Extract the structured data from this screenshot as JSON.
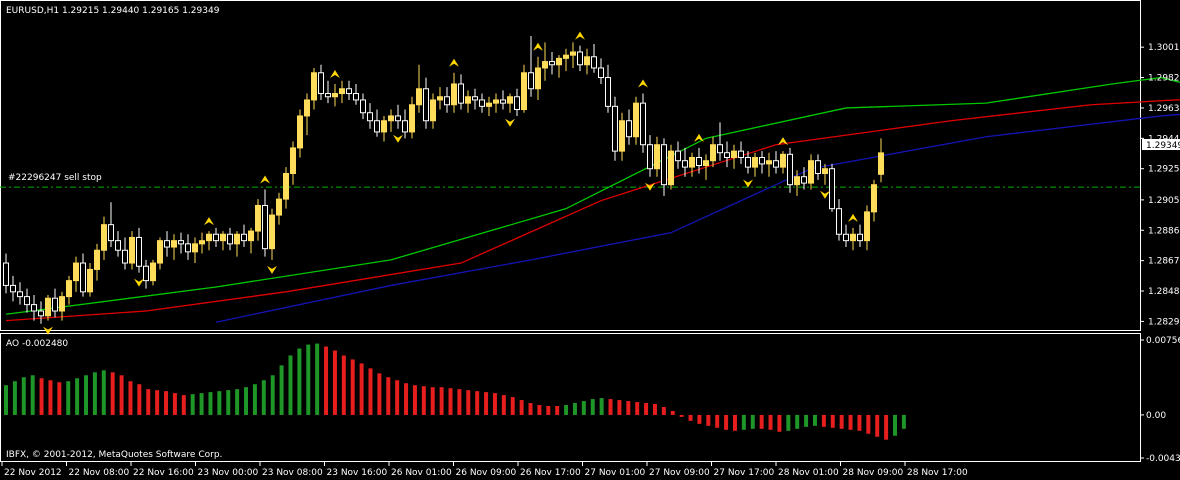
{
  "main_panel": {
    "title": "EURUSD,H1  1.29215 1.29440 1.29165 1.29349",
    "order_label": "#22296247 sell stop",
    "current_price_label": "1.29349"
  },
  "ao_panel": {
    "title": "AO -0.002480"
  },
  "copyright": "IBFX, © 2001-2012, MetaQuotes Software Corp.",
  "colors": {
    "background": "#000000",
    "grid_frame": "#ffffff",
    "bull_candle": "#ffdc5a",
    "bear_candle": "#ffffff",
    "ma_fast": "#00c800",
    "ma_mid": "#e00000",
    "ma_slow": "#1414b4",
    "order_line": "#00b000",
    "fractal": "#ffd700",
    "ao_up": "#1e9628",
    "ao_down": "#e61e1e"
  },
  "chart_data": [
    {
      "type": "candlestick",
      "symbol": "EURUSD",
      "timeframe": "H1",
      "last_bar": {
        "open": 1.29215,
        "high": 1.2944,
        "low": 1.29165,
        "close": 1.29349
      },
      "y_ticks": [
        "1.30010",
        "1.29820",
        "1.29630",
        "1.29440",
        "1.29250",
        "1.29055",
        "1.28865",
        "1.28675",
        "1.28485",
        "1.28295"
      ],
      "ylim": [
        1.2826,
        1.3018
      ],
      "x_ticks": [
        "22 Nov 2012",
        "22 Nov 08:00",
        "22 Nov 16:00",
        "23 Nov 00:00",
        "23 Nov 08:00",
        "23 Nov 16:00",
        "26 Nov 01:00",
        "26 Nov 09:00",
        "26 Nov 17:00",
        "27 Nov 01:00",
        "27 Nov 09:00",
        "27 Nov 17:00",
        "28 Nov 01:00",
        "28 Nov 09:00",
        "28 Nov 17:00"
      ],
      "order_line": {
        "label": "#22296247 sell stop",
        "price": 1.29135
      },
      "candles_ohlc": [
        [
          1.2866,
          1.2872,
          1.2847,
          1.2852
        ],
        [
          1.2852,
          1.2858,
          1.2842,
          1.2848
        ],
        [
          1.2848,
          1.2854,
          1.284,
          1.2845
        ],
        [
          1.2845,
          1.285,
          1.2835,
          1.284
        ],
        [
          1.284,
          1.2846,
          1.283,
          1.2836
        ],
        [
          1.2836,
          1.2842,
          1.2828,
          1.2833
        ],
        [
          1.2833,
          1.2846,
          1.283,
          1.2844
        ],
        [
          1.2844,
          1.285,
          1.2832,
          1.2836
        ],
        [
          1.2836,
          1.2848,
          1.283,
          1.2845
        ],
        [
          1.2845,
          1.2858,
          1.284,
          1.2855
        ],
        [
          1.2855,
          1.287,
          1.2848,
          1.2866
        ],
        [
          1.2866,
          1.2872,
          1.2845,
          1.2848
        ],
        [
          1.2848,
          1.2866,
          1.2845,
          1.2862
        ],
        [
          1.2862,
          1.2878,
          1.2855,
          1.2874
        ],
        [
          1.2874,
          1.2895,
          1.2868,
          1.289
        ],
        [
          1.289,
          1.2904,
          1.2876,
          1.288
        ],
        [
          1.288,
          1.2886,
          1.287,
          1.2874
        ],
        [
          1.2874,
          1.2882,
          1.2862,
          1.2866
        ],
        [
          1.2866,
          1.2886,
          1.2862,
          1.2882
        ],
        [
          1.2882,
          1.2888,
          1.286,
          1.2864
        ],
        [
          1.2864,
          1.2868,
          1.285,
          1.2855
        ],
        [
          1.2855,
          1.2868,
          1.2852,
          1.2866
        ],
        [
          1.2866,
          1.2882,
          1.2862,
          1.288
        ],
        [
          1.288,
          1.2886,
          1.287,
          1.2876
        ],
        [
          1.2876,
          1.2884,
          1.2868,
          1.288
        ],
        [
          1.288,
          1.2885,
          1.2872,
          1.2878
        ],
        [
          1.2878,
          1.2884,
          1.2868,
          1.2873
        ],
        [
          1.2873,
          1.2882,
          1.2866,
          1.2878
        ],
        [
          1.2878,
          1.2885,
          1.2872,
          1.288
        ],
        [
          1.288,
          1.2886,
          1.2874,
          1.2884
        ],
        [
          1.2884,
          1.2888,
          1.2876,
          1.288
        ],
        [
          1.288,
          1.2886,
          1.2874,
          1.2884
        ],
        [
          1.2884,
          1.2888,
          1.2874,
          1.2878
        ],
        [
          1.2878,
          1.2886,
          1.287,
          1.2884
        ],
        [
          1.2884,
          1.289,
          1.2876,
          1.288
        ],
        [
          1.288,
          1.2888,
          1.2872,
          1.2886
        ],
        [
          1.2886,
          1.2906,
          1.288,
          1.2902
        ],
        [
          1.2902,
          1.2912,
          1.287,
          1.2875
        ],
        [
          1.2875,
          1.29,
          1.2868,
          1.2896
        ],
        [
          1.2896,
          1.291,
          1.289,
          1.2906
        ],
        [
          1.2906,
          1.2926,
          1.29,
          1.2922
        ],
        [
          1.2922,
          1.2942,
          1.2915,
          1.2938
        ],
        [
          1.2938,
          1.2962,
          1.2932,
          1.2958
        ],
        [
          1.2958,
          1.2972,
          1.2946,
          1.2968
        ],
        [
          1.2968,
          1.2988,
          1.2962,
          1.2985
        ],
        [
          1.2985,
          1.299,
          1.2968,
          1.2972
        ],
        [
          1.2972,
          1.298,
          1.2966,
          1.297
        ],
        [
          1.297,
          1.2978,
          1.2964,
          1.2972
        ],
        [
          1.2972,
          1.298,
          1.2966,
          1.2975
        ],
        [
          1.2975,
          1.298,
          1.2968,
          1.2972
        ],
        [
          1.2972,
          1.2978,
          1.2965,
          1.2968
        ],
        [
          1.2968,
          1.2972,
          1.2956,
          1.296
        ],
        [
          1.296,
          1.2966,
          1.295,
          1.2955
        ],
        [
          1.2955,
          1.2962,
          1.2945,
          1.2948
        ],
        [
          1.2948,
          1.2958,
          1.2942,
          1.2955
        ],
        [
          1.2955,
          1.2962,
          1.2948,
          1.2958
        ],
        [
          1.2958,
          1.2965,
          1.295,
          1.2955
        ],
        [
          1.2955,
          1.2962,
          1.2944,
          1.2948
        ],
        [
          1.2948,
          1.297,
          1.2944,
          1.2965
        ],
        [
          1.2965,
          1.299,
          1.296,
          1.2975
        ],
        [
          1.2975,
          1.2982,
          1.295,
          1.2955
        ],
        [
          1.2955,
          1.2972,
          1.295,
          1.2968
        ],
        [
          1.2968,
          1.2976,
          1.2962,
          1.297
        ],
        [
          1.297,
          1.2976,
          1.296,
          1.2965
        ],
        [
          1.2965,
          1.2985,
          1.296,
          1.2978
        ],
        [
          1.2978,
          1.2984,
          1.2962,
          1.2966
        ],
        [
          1.2966,
          1.2974,
          1.296,
          1.297
        ],
        [
          1.297,
          1.2975,
          1.2962,
          1.2968
        ],
        [
          1.2968,
          1.2972,
          1.296,
          1.2964
        ],
        [
          1.2964,
          1.297,
          1.2958,
          1.2966
        ],
        [
          1.2966,
          1.2972,
          1.296,
          1.2968
        ],
        [
          1.2968,
          1.2974,
          1.2962,
          1.2966
        ],
        [
          1.2966,
          1.2972,
          1.296,
          1.297
        ],
        [
          1.297,
          1.2975,
          1.2958,
          1.2962
        ],
        [
          1.2962,
          1.299,
          1.296,
          1.2985
        ],
        [
          1.2985,
          1.3008,
          1.297,
          1.2975
        ],
        [
          1.2975,
          1.2995,
          1.2968,
          1.2988
        ],
        [
          1.2988,
          1.3004,
          1.298,
          1.2992
        ],
        [
          1.2992,
          1.2998,
          1.2984,
          1.299
        ],
        [
          1.299,
          1.2996,
          1.2982,
          1.2994
        ],
        [
          1.2994,
          1.3,
          1.2986,
          1.2996
        ],
        [
          1.2996,
          1.3004,
          1.2988,
          1.2998
        ],
        [
          1.2998,
          1.3002,
          1.2986,
          1.299
        ],
        [
          1.299,
          1.3,
          1.2984,
          1.2995
        ],
        [
          1.2995,
          1.3003,
          1.2985,
          1.2988
        ],
        [
          1.2988,
          1.2994,
          1.2978,
          1.2982
        ],
        [
          1.2982,
          1.299,
          1.296,
          1.2964
        ],
        [
          1.2964,
          1.297,
          1.293,
          1.2936
        ],
        [
          1.2936,
          1.296,
          1.293,
          1.2955
        ],
        [
          1.2955,
          1.2962,
          1.294,
          1.2945
        ],
        [
          1.2945,
          1.297,
          1.294,
          1.2966
        ],
        [
          1.2966,
          1.2972,
          1.2935,
          1.294
        ],
        [
          1.294,
          1.2946,
          1.292,
          1.2925
        ],
        [
          1.2925,
          1.2945,
          1.292,
          1.294
        ],
        [
          1.294,
          1.2944,
          1.2908,
          1.2915
        ],
        [
          1.2915,
          1.294,
          1.2912,
          1.2936
        ],
        [
          1.2936,
          1.2942,
          1.2925,
          1.293
        ],
        [
          1.293,
          1.2938,
          1.292,
          1.2926
        ],
        [
          1.2926,
          1.2935,
          1.292,
          1.2932
        ],
        [
          1.2932,
          1.2938,
          1.2922,
          1.2927
        ],
        [
          1.2927,
          1.2934,
          1.2918,
          1.293
        ],
        [
          1.293,
          1.2945,
          1.2926,
          1.294
        ],
        [
          1.294,
          1.2954,
          1.293,
          1.2935
        ],
        [
          1.2935,
          1.2942,
          1.2926,
          1.2932
        ],
        [
          1.2932,
          1.294,
          1.2925,
          1.2936
        ],
        [
          1.2936,
          1.2942,
          1.2928,
          1.2932
        ],
        [
          1.2932,
          1.2936,
          1.2922,
          1.2926
        ],
        [
          1.2926,
          1.2935,
          1.292,
          1.2932
        ],
        [
          1.2932,
          1.2936,
          1.2922,
          1.2928
        ],
        [
          1.2928,
          1.2935,
          1.292,
          1.293
        ],
        [
          1.293,
          1.2936,
          1.2922,
          1.2926
        ],
        [
          1.2926,
          1.2936,
          1.2922,
          1.2934
        ],
        [
          1.2934,
          1.2938,
          1.291,
          1.2915
        ],
        [
          1.2915,
          1.2924,
          1.2908,
          1.292
        ],
        [
          1.292,
          1.2926,
          1.2912,
          1.2916
        ],
        [
          1.2916,
          1.2934,
          1.2912,
          1.293
        ],
        [
          1.293,
          1.2934,
          1.2918,
          1.2922
        ],
        [
          1.2922,
          1.2928,
          1.2915,
          1.2925
        ],
        [
          1.2925,
          1.2928,
          1.2898,
          1.29
        ],
        [
          1.29,
          1.2906,
          1.288,
          1.2884
        ],
        [
          1.2884,
          1.289,
          1.2876,
          1.288
        ],
        [
          1.288,
          1.2888,
          1.2874,
          1.2884
        ],
        [
          1.2884,
          1.289,
          1.2876,
          1.288
        ],
        [
          1.288,
          1.2902,
          1.2874,
          1.2898
        ],
        [
          1.2898,
          1.2918,
          1.2892,
          1.2915
        ],
        [
          1.29215,
          1.2944,
          1.29165,
          1.29349
        ]
      ],
      "series": [
        {
          "name": "",
          "color": "#00c800",
          "points": [
            [
              0,
              1.2834
            ],
            [
              30,
              1.2851
            ],
            [
              55,
              1.2868
            ],
            [
              80,
              1.29
            ],
            [
              100,
              1.2944
            ],
            [
              120,
              1.2963
            ],
            [
              140,
              1.2966
            ],
            [
              158,
              1.2978
            ],
            [
              165,
              1.2982
            ],
            [
              185,
              1.296
            ],
            [
              200,
              1.2944
            ],
            [
              225,
              1.293
            ],
            [
              240,
              1.2925
            ],
            [
              260,
              1.291
            ],
            [
              265,
              1.2916
            ]
          ]
        },
        {
          "name": "",
          "color": "#e00000",
          "points": [
            [
              0,
              1.283
            ],
            [
              20,
              1.2836
            ],
            [
              40,
              1.2848
            ],
            [
              65,
              1.2866
            ],
            [
              85,
              1.2905
            ],
            [
              110,
              1.294
            ],
            [
              135,
              1.2955
            ],
            [
              155,
              1.2965
            ],
            [
              175,
              1.297
            ],
            [
              195,
              1.2955
            ],
            [
              220,
              1.2942
            ],
            [
              245,
              1.2932
            ],
            [
              260,
              1.2918
            ],
            [
              268,
              1.292
            ]
          ]
        },
        {
          "name": "",
          "color": "#1414b4",
          "points": [
            [
              30,
              1.2829
            ],
            [
              55,
              1.2852
            ],
            [
              75,
              1.2868
            ],
            [
              95,
              1.2885
            ],
            [
              115,
              1.2925
            ],
            [
              140,
              1.2945
            ],
            [
              165,
              1.2958
            ],
            [
              185,
              1.2965
            ],
            [
              210,
              1.2955
            ],
            [
              235,
              1.2942
            ],
            [
              258,
              1.2935
            ],
            [
              275,
              1.2926
            ]
          ]
        }
      ],
      "fractals_up_index": [
        29,
        37,
        47,
        64,
        76,
        82,
        91,
        99,
        111,
        121
      ],
      "fractals_down_index": [
        6,
        19,
        38,
        56,
        72,
        92,
        106,
        117,
        126
      ]
    },
    {
      "type": "bar",
      "name": "AO",
      "y_ticks": [
        "0.007560",
        "0.00",
        "-0.004345"
      ],
      "ylim": [
        -0.004345,
        0.00756
      ],
      "values": [
        0.003,
        0.0034,
        0.0038,
        0.004,
        0.0037,
        0.0035,
        0.0033,
        0.0034,
        0.0037,
        0.004,
        0.0043,
        0.0045,
        0.0043,
        0.004,
        0.0034,
        0.0031,
        0.0026,
        0.0025,
        0.0024,
        0.0022,
        0.002,
        0.0021,
        0.0022,
        0.0023,
        0.0024,
        0.0025,
        0.0026,
        0.0028,
        0.0031,
        0.0035,
        0.004,
        0.005,
        0.006,
        0.0067,
        0.0071,
        0.0072,
        0.0069,
        0.0065,
        0.006,
        0.0056,
        0.0052,
        0.0047,
        0.0042,
        0.0038,
        0.0035,
        0.0032,
        0.003,
        0.0029,
        0.0028,
        0.0028,
        0.0027,
        0.0026,
        0.0025,
        0.0024,
        0.0023,
        0.0022,
        0.002,
        0.0018,
        0.0015,
        0.0012,
        0.001,
        0.0009,
        0.0009,
        0.001,
        0.0012,
        0.0014,
        0.0016,
        0.0017,
        0.0016,
        0.0015,
        0.0014,
        0.0013,
        0.0012,
        0.0011,
        0.0008,
        0.0004,
        -0.0002,
        -0.0006,
        -0.0009,
        -0.0011,
        -0.0013,
        -0.0015,
        -0.0016,
        -0.0015,
        -0.0014,
        -0.0014,
        -0.0015,
        -0.0017,
        -0.0016,
        -0.0014,
        -0.0012,
        -0.0011,
        -0.0012,
        -0.0013,
        -0.0014,
        -0.0015,
        -0.0016,
        -0.0019,
        -0.0022,
        -0.0025,
        -0.0021,
        -0.0014
      ],
      "colors_rule": "green if value greater than previous, red otherwise"
    }
  ]
}
